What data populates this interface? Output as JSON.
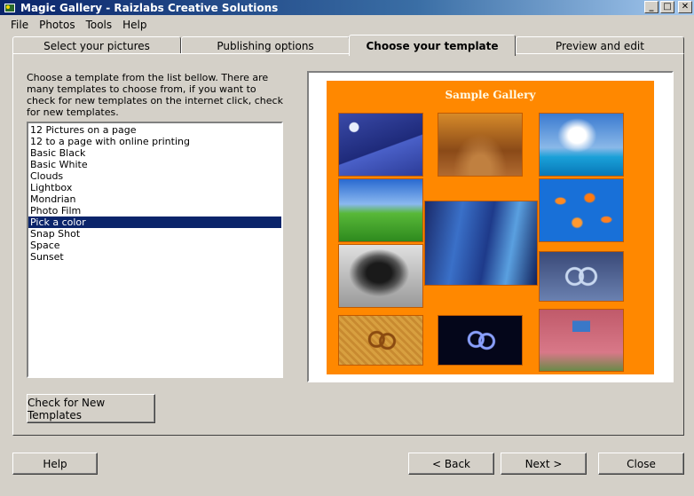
{
  "window": {
    "title": "Magic Gallery - Raizlabs Creative Solutions",
    "minimize_glyph": "_",
    "maximize_glyph": "□",
    "close_glyph": "✕"
  },
  "menu": {
    "file": "File",
    "photos": "Photos",
    "tools": "Tools",
    "help": "Help"
  },
  "tabs": [
    {
      "label": "Select your pictures",
      "active": false
    },
    {
      "label": "Publishing options",
      "active": false
    },
    {
      "label": "Choose your template",
      "active": true
    },
    {
      "label": "Preview and edit",
      "active": false
    }
  ],
  "instructions": "Choose a template from the list bellow.  There are many templates to choose from, if you want to check for new templates on the internet click, check for new templates.",
  "templates": [
    "12  Pictures on a page",
    "12 to a page with online printing",
    "Basic Black",
    "Basic White",
    "Clouds",
    "Lightbox",
    "Mondrian",
    "Photo Film",
    "Pick a color",
    "Snap Shot",
    "Space",
    "Sunset"
  ],
  "selected_template": "Pick a color",
  "check_button": "Check for New Templates",
  "preview": {
    "title": "Sample Gallery",
    "background_color": "#ff8800",
    "thumbnails": [
      "mountain",
      "autumn-path",
      "ocean-sky",
      "green-hill",
      "abstract-blue",
      "goldfish",
      "sculpture",
      "cloud-logo",
      "sand-pattern",
      "space-logo",
      "pink-house"
    ]
  },
  "bottom_buttons": {
    "help": "Help",
    "back": "< Back",
    "next": "Next >",
    "close": "Close"
  },
  "colors": {
    "selection": "#0a246a",
    "face": "#d4d0c8",
    "title_gradient_start": "#0a246a"
  }
}
